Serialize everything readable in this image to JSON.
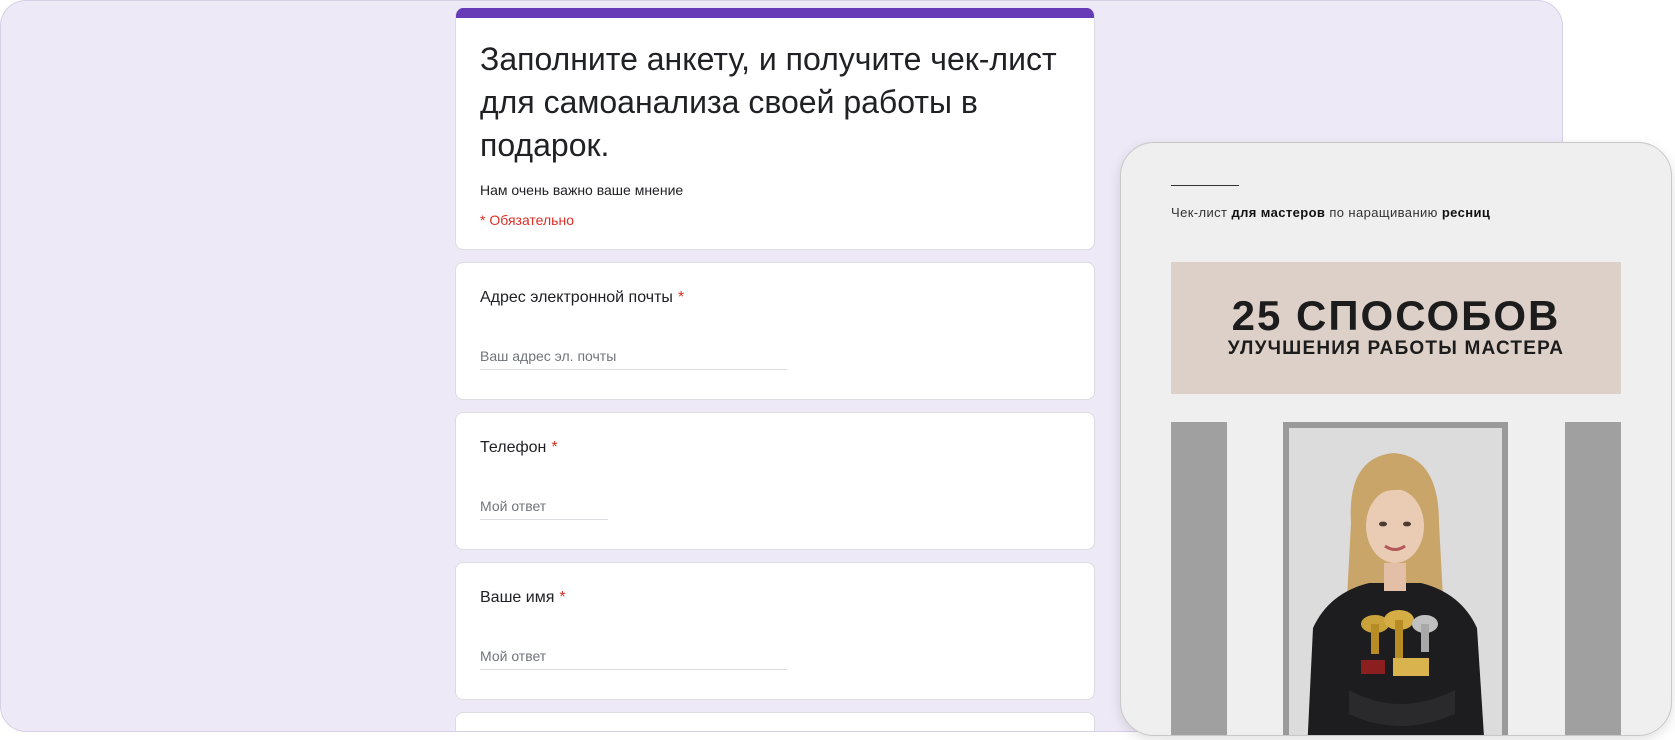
{
  "form": {
    "title": "Заполните анкету, и получите чек-лист для самоанализа своей работы в подарок.",
    "description": "Нам очень важно ваше мнение",
    "required_note": "* Обязательно",
    "questions": [
      {
        "label": "Адрес электронной почты",
        "placeholder": "Ваш адрес эл. почты"
      },
      {
        "label": "Телефон",
        "placeholder": "Мой ответ"
      },
      {
        "label": "Ваше имя",
        "placeholder": "Мой ответ"
      }
    ],
    "required_mark": "*"
  },
  "checklist": {
    "subtitle_part1": "Чек-лист ",
    "subtitle_bold1": "для мастеров",
    "subtitle_part2": " по наращиванию ",
    "subtitle_bold2": "ресниц",
    "banner_title": "25 СПОСОБОВ",
    "banner_subtitle": "УЛУЧШЕНИЯ РАБОТЫ МАСТЕРА"
  },
  "colors": {
    "accent": "#673ab7",
    "required": "#d93025",
    "background": "#eee9f6",
    "banner": "#ddd0c8"
  }
}
